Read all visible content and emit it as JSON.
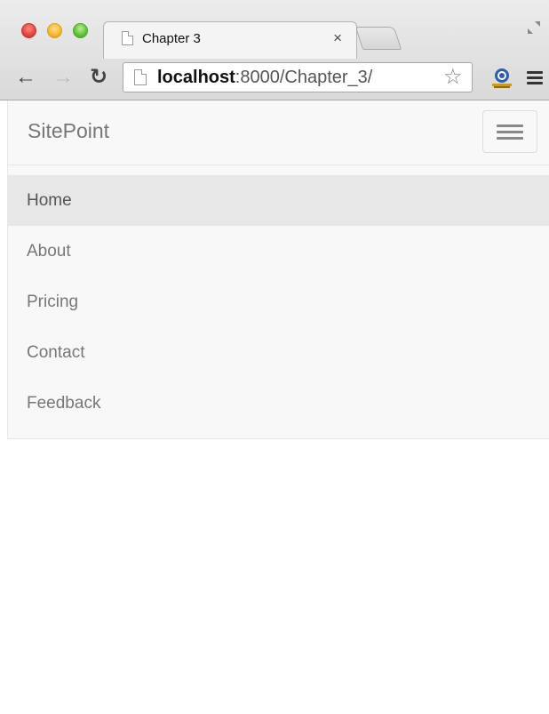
{
  "browser": {
    "tab_title": "Chapter 3",
    "tab_close": "×",
    "url_host": "localhost",
    "url_rest": ":8000/Chapter_3/",
    "icons": {
      "back": "back-arrow-icon",
      "forward": "forward-arrow-icon",
      "reload": "reload-icon",
      "bookmark": "star-icon",
      "extension": "extension-icon",
      "menu": "menu-icon",
      "fullscreen": "fullscreen-icon"
    }
  },
  "site": {
    "brand": "SitePoint",
    "menu_items": [
      {
        "label": "Home",
        "active": true
      },
      {
        "label": "About",
        "active": false
      },
      {
        "label": "Pricing",
        "active": false
      },
      {
        "label": "Contact",
        "active": false
      },
      {
        "label": "Feedback",
        "active": false
      }
    ]
  }
}
